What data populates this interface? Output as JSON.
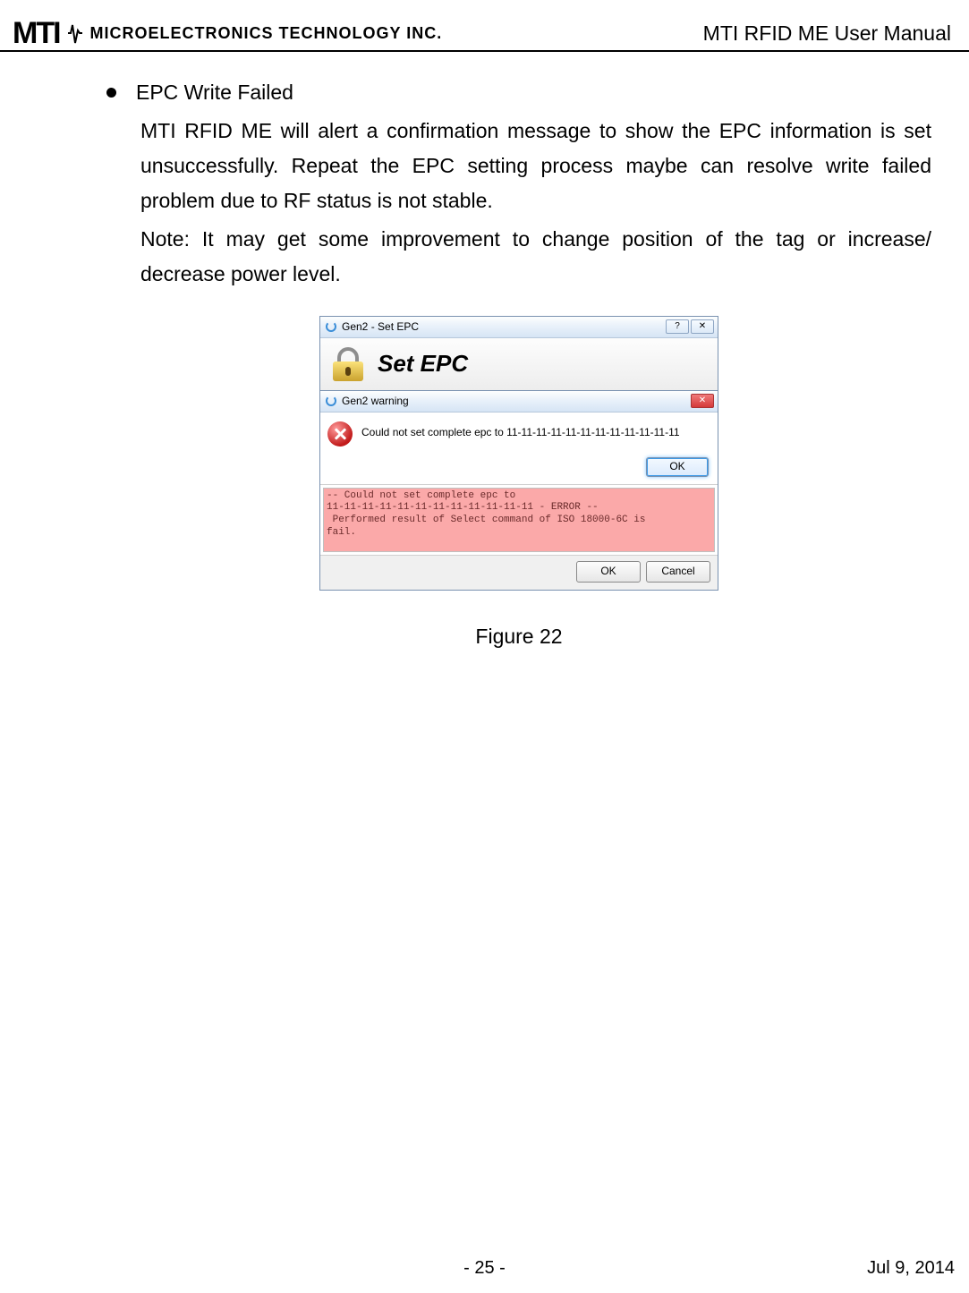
{
  "header": {
    "logo_mark": "MTI",
    "logo_long": "Microelectronics Technology Inc.",
    "doc_title": "MTI RFID ME User Manual"
  },
  "content": {
    "bullet_title": "EPC Write Failed",
    "para1": "MTI RFID ME will alert a confirmation message to show the EPC information is set unsuccessfully. Repeat the EPC setting process maybe can resolve write failed problem due to RF status is not stable.",
    "para2": "Note: It may get some improvement to change position of the tag or increase/ decrease power level."
  },
  "dialog1": {
    "title": "Gen2 - Set EPC",
    "heading": "Set EPC",
    "help_glyph": "?",
    "close_glyph": "✕"
  },
  "dialog2": {
    "title": "Gen2 warning",
    "message": "Could not set complete epc to 11-11-11-11-11-11-11-11-11-11-11-11",
    "ok_label": "OK",
    "close_glyph": "✕"
  },
  "log": {
    "text": "-- Could not set complete epc to\n11-11-11-11-11-11-11-11-11-11-11-11 - ERROR --\n Performed result of Select command of ISO 18000-6C is\nfail."
  },
  "buttons": {
    "ok": "OK",
    "cancel": "Cancel"
  },
  "figure_caption": "Figure 22",
  "footer": {
    "page": "-  25  -",
    "date": "Jul  9,  2014"
  }
}
